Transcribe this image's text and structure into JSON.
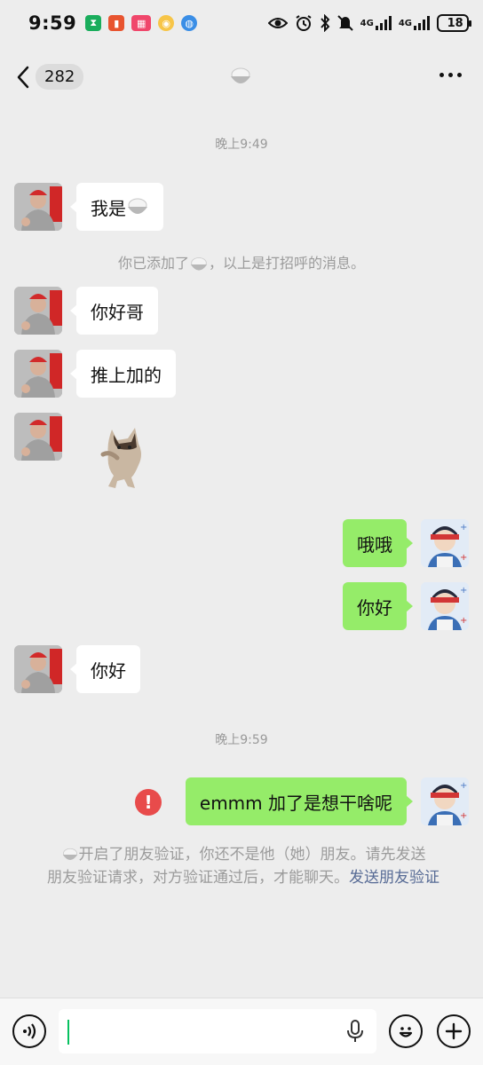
{
  "status_bar": {
    "time": "9:59",
    "network_1": "4G",
    "network_2": "4G",
    "battery": "18",
    "battery_level_percent": 18
  },
  "header": {
    "unread_count": "282",
    "title_icon": "rice-bowl-icon"
  },
  "messages": [
    {
      "type": "time",
      "text": "晚上9:49"
    },
    {
      "type": "left",
      "text": "我是",
      "emoji": "rice-bowl-icon"
    },
    {
      "type": "system",
      "text_before": "你已添加了",
      "emoji": "rice-bowl-icon",
      "text_after": "，以上是打招呼的消息。"
    },
    {
      "type": "left",
      "text": "你好哥"
    },
    {
      "type": "left",
      "text": "推上加的"
    },
    {
      "type": "left-sticker",
      "sticker": "dancing-cat-sticker"
    },
    {
      "type": "right",
      "text": "哦哦"
    },
    {
      "type": "right",
      "text": "你好"
    },
    {
      "type": "left",
      "text": "你好"
    },
    {
      "type": "time",
      "text": "晚上9:59"
    },
    {
      "type": "right-failed",
      "text": "emmm 加了是想干啥呢"
    }
  ],
  "notice": {
    "line1": "开启了朋友验证，你还不是他（她）朋友。请先发送",
    "line2": "朋友验证请求，对方验证通过后，才能聊天。",
    "link": "发送朋友验证"
  },
  "input_bar": {
    "voice_icon": "voice-icon",
    "mic_icon": "microphone-icon",
    "emoji_icon": "emoji-icon",
    "plus_icon": "plus-icon"
  },
  "colors": {
    "background": "#ededed",
    "bubble_self": "#95ec69",
    "bubble_other": "#ffffff",
    "link": "#576b95",
    "error": "#e84b4b"
  }
}
